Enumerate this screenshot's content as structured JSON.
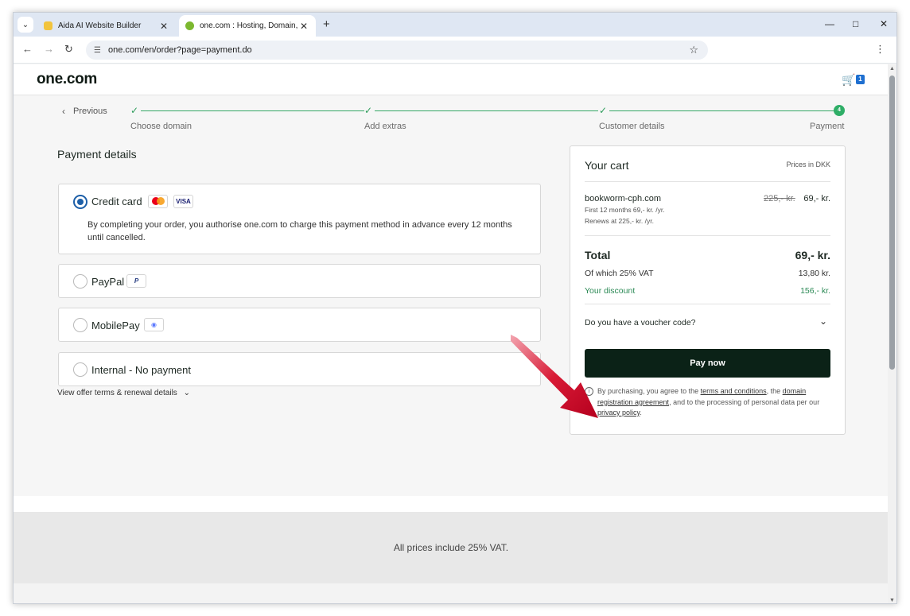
{
  "browser": {
    "tabs": [
      {
        "title": "Aida AI Website Builder",
        "favicon_color": "#f2c43d",
        "active": false
      },
      {
        "title": "one.com : Hosting, Domain, Em",
        "favicon_color": "#7cb82f",
        "active": true
      }
    ],
    "url": "one.com/en/order?page=payment.do"
  },
  "header": {
    "logo": "one.com",
    "cart_count": "1"
  },
  "stepper": {
    "previous_label": "Previous",
    "steps": [
      "Choose domain",
      "Add extras",
      "Customer details",
      "Payment"
    ],
    "current_step_number": "4"
  },
  "payment": {
    "title": "Payment details",
    "selected": "Credit card",
    "options": [
      {
        "label": "Credit card",
        "badges": [
          "mastercard",
          "VISA"
        ]
      },
      {
        "label": "PayPal",
        "badges": [
          "P"
        ]
      },
      {
        "label": "MobilePay",
        "badges": [
          "mobilepay"
        ]
      },
      {
        "label": "Internal - No payment",
        "badges": []
      }
    ],
    "credit_card_description": "By completing your order, you authorise one.com to charge this payment method in advance every 12 months until cancelled.",
    "terms_link": "View offer terms & renewal details"
  },
  "cart": {
    "title": "Your cart",
    "prices_in": "Prices in DKK",
    "item": {
      "name": "bookworm-cph.com",
      "sub1": "First 12 months 69,- kr. /yr.",
      "sub2": "Renews at 225,- kr. /yr.",
      "old_price": "225,- kr.",
      "price": "69,- kr."
    },
    "total_label": "Total",
    "total_value": "69,- kr.",
    "vat_label": "Of which 25% VAT",
    "vat_value": "13,80 kr.",
    "discount_label": "Your discount",
    "discount_value": "156,- kr.",
    "voucher_label": "Do you have a voucher code?",
    "pay_button": "Pay now",
    "legal": {
      "part1": "By purchasing, you agree to the ",
      "terms": "terms and conditions",
      "part2": ", the ",
      "domain_agreement": "domain registration agreement",
      "part3": ", and to the processing of personal data per our ",
      "privacy": "privacy policy",
      "part4": "."
    }
  },
  "footer": {
    "text": "All prices include 25% VAT."
  },
  "colors": {
    "primary_button": "#0b2217",
    "step_green": "#34a765",
    "discount_green": "#2c8a56",
    "radio_blue": "#1d5fa8",
    "arrow_red": "#d0102a"
  }
}
